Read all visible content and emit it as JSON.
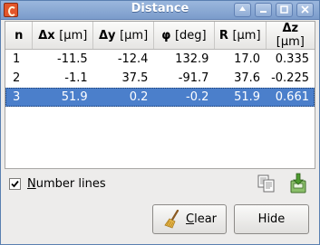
{
  "window": {
    "title": "Distance"
  },
  "table": {
    "columns": [
      {
        "symbol": "n",
        "unit": ""
      },
      {
        "symbol": "Δx",
        "unit": "[µm]"
      },
      {
        "symbol": "Δy",
        "unit": "[µm]"
      },
      {
        "symbol": "φ",
        "unit": "[deg]"
      },
      {
        "symbol": "R",
        "unit": "[µm]"
      },
      {
        "symbol": "Δz",
        "unit": "[µm]"
      }
    ],
    "rows": [
      [
        "1",
        "-11.5",
        "-12.4",
        "132.9",
        "17.0",
        "0.335"
      ],
      [
        "2",
        "-1.1",
        "37.5",
        "-91.7",
        "37.6",
        "-0.225"
      ],
      [
        "3",
        "51.9",
        "0.2",
        "-0.2",
        "51.9",
        "0.661"
      ]
    ],
    "selected_row": "3"
  },
  "options": {
    "number_lines": {
      "label_first": "N",
      "label_rest": "umber lines",
      "checked": true
    }
  },
  "buttons": {
    "clear_first": "C",
    "clear_rest": "lear",
    "hide": "Hide"
  },
  "icons": {
    "app": "gwyddion-app-icon",
    "copy": "copy-icon",
    "save": "save-icon",
    "clear": "broom-icon"
  },
  "colors": {
    "selection": "#4b7fcb",
    "titlebar": "#8aa8d3"
  }
}
